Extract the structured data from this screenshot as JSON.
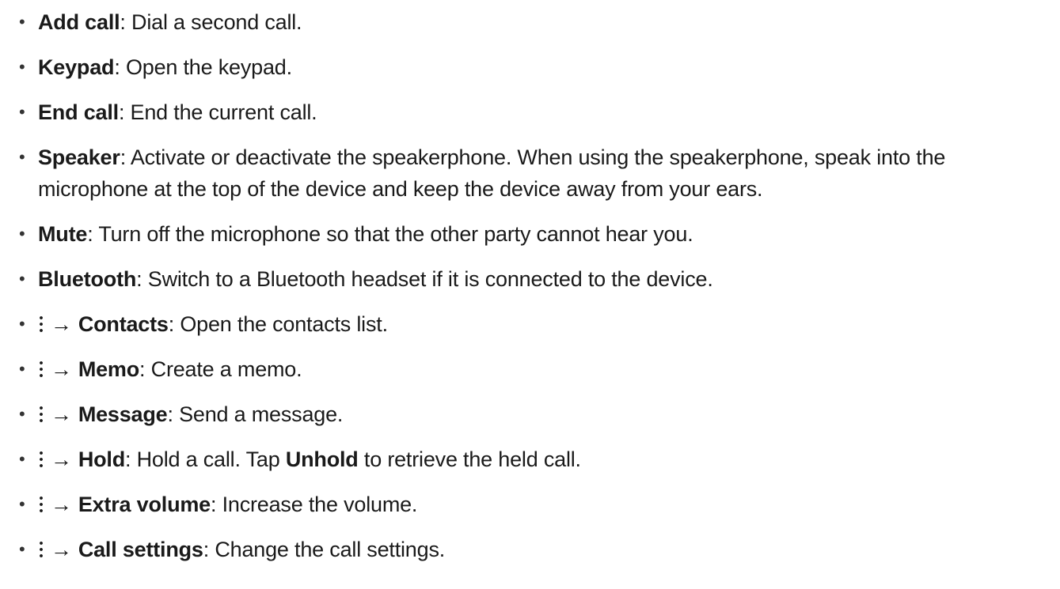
{
  "items": [
    {
      "term": "Add call",
      "sep": ": ",
      "desc": "Dial a second call."
    },
    {
      "term": "Keypad",
      "sep": ": ",
      "desc": "Open the keypad."
    },
    {
      "term": "End call",
      "sep": ": ",
      "desc": "End the current call."
    },
    {
      "term": "Speaker",
      "sep": ": ",
      "desc": "Activate or deactivate the speakerphone. When using the speakerphone, speak into the microphone at the top of the device and keep the device away from your ears."
    },
    {
      "term": "Mute",
      "sep": ": ",
      "desc": "Turn off the microphone so that the other party cannot hear you."
    },
    {
      "term": "Bluetooth",
      "sep": ": ",
      "desc": "Switch to a Bluetooth headset if it is connected to the device."
    },
    {
      "icon": "more-options-icon",
      "arrow": "→",
      "term": "Contacts",
      "sep": ": ",
      "desc": "Open the contacts list."
    },
    {
      "icon": "more-options-icon",
      "arrow": "→",
      "term": "Memo",
      "sep": ": ",
      "desc": "Create a memo."
    },
    {
      "icon": "more-options-icon",
      "arrow": "→",
      "term": "Message",
      "sep": ": ",
      "desc": "Send a message."
    },
    {
      "icon": "more-options-icon",
      "arrow": "→",
      "term": "Hold",
      "sep": ": ",
      "desc": "Hold a call. Tap ",
      "term2": "Unhold",
      "desc2": " to retrieve the held call."
    },
    {
      "icon": "more-options-icon",
      "arrow": "→",
      "term": "Extra volume",
      "sep": ": ",
      "desc": "Increase the volume."
    },
    {
      "icon": "more-options-icon",
      "arrow": "→",
      "term": "Call settings",
      "sep": ": ",
      "desc": "Change the call settings."
    }
  ],
  "bullet": "•"
}
